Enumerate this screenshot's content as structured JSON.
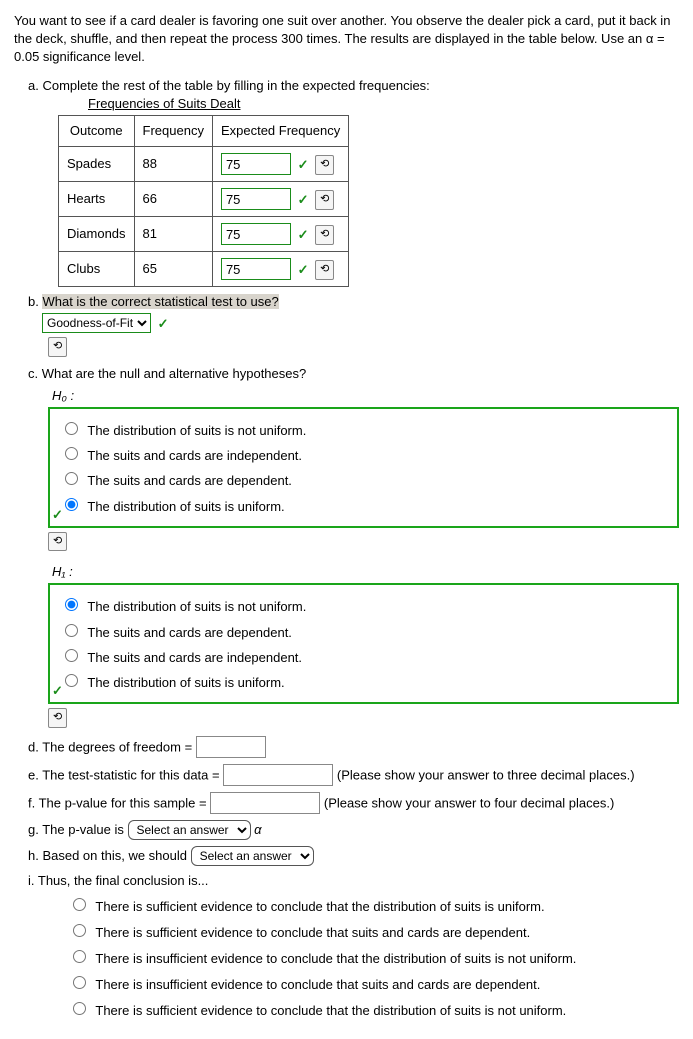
{
  "intro": "You want to see if a card dealer is favoring one suit over another. You observe the dealer pick a card, put it back in the deck, shuffle, and then repeat the process 300 times. The results are displayed in the table below.  Use an α = 0.05 significance level.",
  "a": {
    "prompt": "a. Complete the rest of the table by filling in the expected frequencies:",
    "table_title": "Frequencies of Suits Dealt",
    "headers": {
      "outcome": "Outcome",
      "freq": "Frequency",
      "exp": "Expected Frequency"
    },
    "rows": [
      {
        "outcome": "Spades",
        "freq": "88",
        "exp": "75"
      },
      {
        "outcome": "Hearts",
        "freq": "66",
        "exp": "75"
      },
      {
        "outcome": "Diamonds",
        "freq": "81",
        "exp": "75"
      },
      {
        "outcome": "Clubs",
        "freq": "65",
        "exp": "75"
      }
    ]
  },
  "b": {
    "prompt": "What is the correct statistical test to use?",
    "selected": "Goodness-of-Fit"
  },
  "c": {
    "prompt": "c. What are the null and alternative hypotheses?",
    "h0_label": "H₀ :",
    "h0_options": [
      {
        "text": "The distribution of suits is not uniform.",
        "checked": false
      },
      {
        "text": "The suits and cards are independent.",
        "checked": false
      },
      {
        "text": "The suits and cards are dependent.",
        "checked": false
      },
      {
        "text": "The distribution of suits is uniform.",
        "checked": true
      }
    ],
    "h1_label": "H₁ :",
    "h1_options": [
      {
        "text": "The distribution of suits is not uniform.",
        "checked": true
      },
      {
        "text": "The suits and cards are dependent.",
        "checked": false
      },
      {
        "text": "The suits and cards are independent.",
        "checked": false
      },
      {
        "text": "The distribution of suits is uniform.",
        "checked": false
      }
    ]
  },
  "d": {
    "prompt": "d. The degrees of freedom ="
  },
  "e": {
    "prompt": "e. The test-statistic for this data =",
    "hint": "(Please show your answer to three decimal places.)"
  },
  "f": {
    "prompt": "f. The p-value for this sample =",
    "hint": "(Please show your answer to four decimal places.)"
  },
  "g": {
    "prompt_pre": "g. The p-value is",
    "select_placeholder": "Select an answer",
    "alpha": "α"
  },
  "h": {
    "prompt_pre": "h. Based on this, we should",
    "select_placeholder": "Select an answer"
  },
  "i": {
    "prompt": "i. Thus, the final conclusion is...",
    "options": [
      "There is sufficient evidence to conclude that the distribution of suits is uniform.",
      "There is sufficient evidence to conclude that suits and cards are dependent.",
      "There is insufficient evidence to conclude that the distribution of suits is not uniform.",
      "There is insufficient evidence to conclude that suits and cards are dependent.",
      "There is sufficient evidence to conclude that the distribution of suits is not uniform."
    ]
  },
  "icons": {
    "retry": "⟲"
  }
}
